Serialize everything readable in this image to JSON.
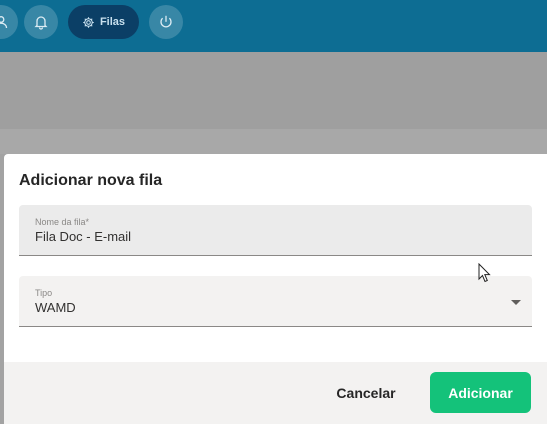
{
  "topbar": {
    "accent_color": "#0d6d93",
    "nav_items": [
      {
        "icon": "user-icon",
        "label": ""
      },
      {
        "icon": "bell-icon",
        "label": ""
      },
      {
        "icon": "gear-icon",
        "label": "Filas",
        "active": true
      },
      {
        "icon": "power-icon",
        "label": ""
      }
    ]
  },
  "dialog": {
    "title": "Adicionar nova fila",
    "fields": {
      "name": {
        "label": "Nome da fila*",
        "value": "Fila Doc - E-mail"
      },
      "type": {
        "label": "Tipo",
        "value": "WAMD",
        "dropdown_icon": "caret-down-icon"
      }
    },
    "buttons": {
      "cancel": "Cancelar",
      "add": "Adicionar",
      "add_color": "#14c27a"
    }
  }
}
